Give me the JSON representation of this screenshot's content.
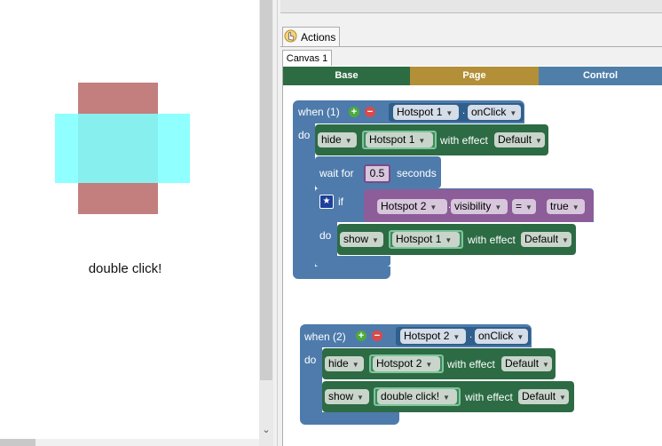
{
  "preview": {
    "label": "double click!",
    "colors": {
      "red_shape": "#c37e7e",
      "cyan_shape": "#80ffff"
    }
  },
  "panel": {
    "tab_label": "Actions",
    "canvas_tab": "Canvas 1",
    "categories": [
      {
        "label": "Base",
        "color": "#2d6b43"
      },
      {
        "label": "Page",
        "color": "#b38f37"
      },
      {
        "label": "Control",
        "color": "#4f7fa9"
      }
    ]
  },
  "block1": {
    "when_label": "when (1)",
    "target": "Hotspot 1",
    "event": "onClick",
    "do_label": "do",
    "hide": {
      "action": "hide",
      "target": "Hotspot 1",
      "effect_label": "with effect",
      "effect": "Default"
    },
    "wait": {
      "label": "wait for",
      "value": "0.5",
      "unit": "seconds"
    },
    "if": {
      "label": "if",
      "target": "Hotspot 2",
      "property": "visibility",
      "operator": "=",
      "value": "true",
      "do_label": "do",
      "show": {
        "action": "show",
        "target": "Hotspot 1",
        "effect_label": "with effect",
        "effect": "Default"
      }
    }
  },
  "block2": {
    "when_label": "when (2)",
    "target": "Hotspot 2",
    "event": "onClick",
    "do_label": "do",
    "hide": {
      "action": "hide",
      "target": "Hotspot 2",
      "effect_label": "with effect",
      "effect": "Default"
    },
    "show": {
      "action": "show",
      "target": "double click!",
      "effect_label": "with effect",
      "effect": "Default"
    }
  }
}
